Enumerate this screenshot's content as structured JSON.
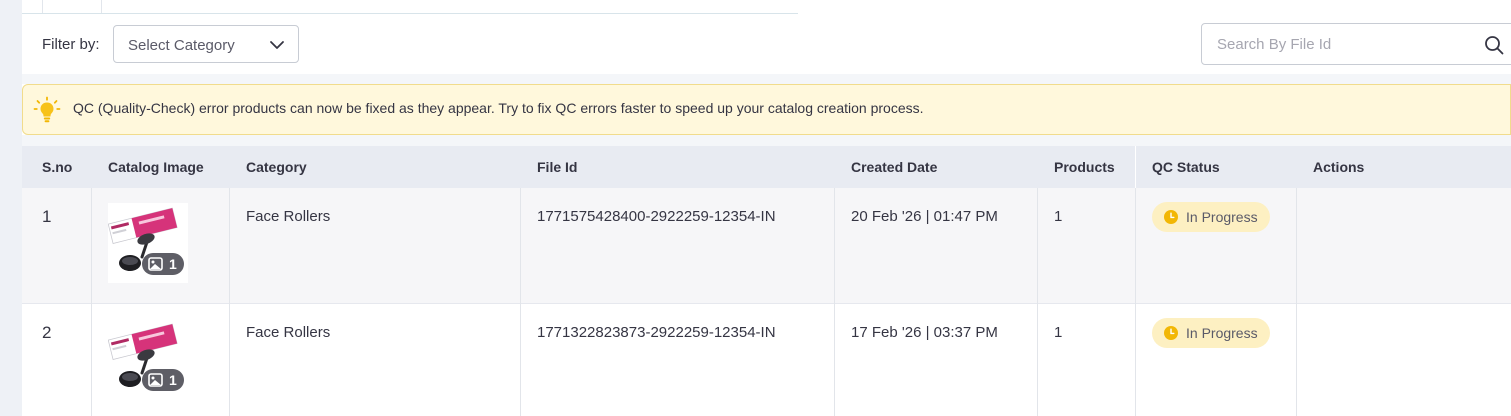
{
  "filter": {
    "label": "Filter by:",
    "select_value": "Select Category"
  },
  "search": {
    "placeholder": "Search By File Id"
  },
  "banner": {
    "text": "QC (Quality-Check) error products can now be fixed as they appear. Try to fix QC errors faster to speed up your catalog creation process.",
    "background_color": "#fff8dc",
    "border_color": "#f1dc8c",
    "icon": "lightbulb-icon"
  },
  "table": {
    "headers": [
      "S.no",
      "Catalog Image",
      "Category",
      "File Id",
      "Created Date",
      "Products",
      "QC Status",
      "Actions"
    ],
    "rows": [
      {
        "sno": "1",
        "image_count": "1",
        "category": "Face Rollers",
        "file_id": "1771575428400-2922259-12354-IN",
        "created_date": "20 Feb '26 | 01:47 PM",
        "products": "1",
        "qc_status": "In Progress"
      },
      {
        "sno": "2",
        "image_count": "1",
        "category": "Face Rollers",
        "file_id": "1771322823873-2922259-12354-IN",
        "created_date": "17 Feb '26 | 03:37 PM",
        "products": "1",
        "qc_status": "In Progress"
      }
    ]
  },
  "colors": {
    "status_pill_bg": "#fdf0c2",
    "status_icon": "#f2b705",
    "header_bg": "#e8ebf2",
    "product_pink": "#d6337a"
  },
  "icons": {
    "select": "chevron-down-icon",
    "search": "search-icon",
    "status": "clock-icon",
    "image_badge": "image-icon"
  }
}
